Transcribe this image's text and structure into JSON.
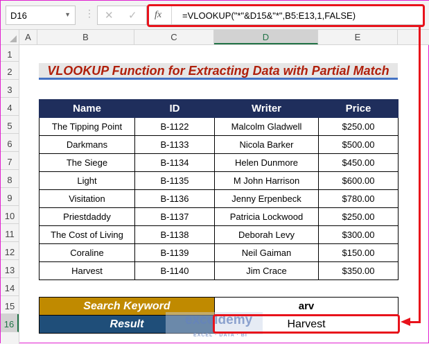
{
  "namebox": "D16",
  "formula": "=VLOOKUP(\"*\"&D15&\"*\",B5:E13,1,FALSE)",
  "fx_label": "fx",
  "cancel": "✕",
  "enter": "✓",
  "columns": [
    "A",
    "B",
    "C",
    "D",
    "E"
  ],
  "rows": [
    "1",
    "2",
    "3",
    "4",
    "5",
    "6",
    "7",
    "8",
    "9",
    "10",
    "11",
    "12",
    "13",
    "14",
    "15",
    "16"
  ],
  "title": "VLOOKUP Function for Extracting Data with Partial Match",
  "headers": [
    "Name",
    "ID",
    "Writer",
    "Price"
  ],
  "data": [
    [
      "The Tipping Point",
      "B-1122",
      "Malcolm Gladwell",
      "$250.00"
    ],
    [
      "Darkmans",
      "B-1133",
      "Nicola Barker",
      "$500.00"
    ],
    [
      "The Siege",
      "B-1134",
      "Helen Dunmore",
      "$450.00"
    ],
    [
      "Light",
      "B-1135",
      "M John Harrison",
      "$600.00"
    ],
    [
      "Visitation",
      "B-1136",
      "Jenny Erpenbeck",
      "$780.00"
    ],
    [
      "Priestdaddy",
      "B-1137",
      "Patricia Lockwood",
      "$250.00"
    ],
    [
      "The Cost of Living",
      "B-1138",
      "Deborah Levy",
      "$300.00"
    ],
    [
      "Coraline",
      "B-1139",
      "Neil Gaiman",
      "$150.00"
    ],
    [
      "Harvest",
      "B-1140",
      "Jim Crace",
      "$350.00"
    ]
  ],
  "search_label": "Search Keyword",
  "search_value": "arv",
  "result_label": "Result",
  "result_value": "Harvest",
  "watermark": "exceldemy",
  "watermark_sub": "EXCEL · DATA · BI"
}
